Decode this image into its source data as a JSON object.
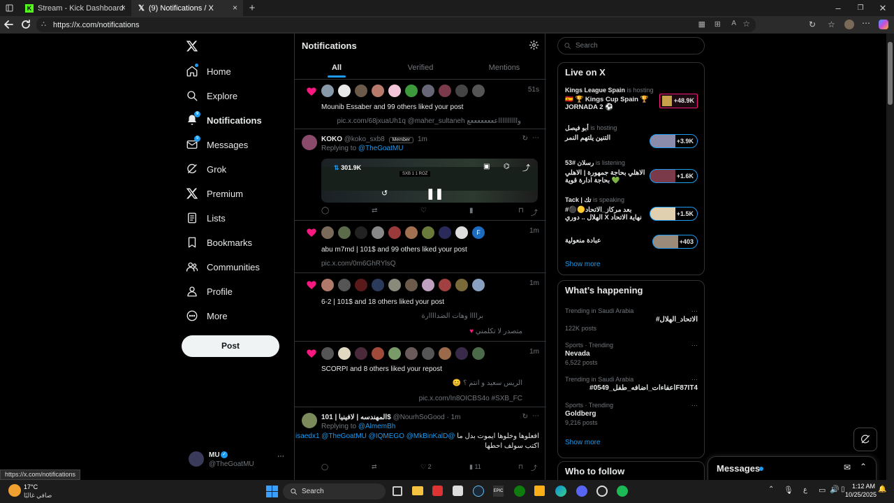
{
  "browser": {
    "tabs": [
      {
        "title": "Stream - Kick Dashboard",
        "active": false
      },
      {
        "title": "(9) Notifications / X",
        "active": true
      }
    ],
    "url": "https://x.com/notifications",
    "status_url": "https://x.com/notifications"
  },
  "nav": {
    "items": [
      {
        "label": "Home",
        "icon": "home-icon"
      },
      {
        "label": "Explore",
        "icon": "search-icon"
      },
      {
        "label": "Notifications",
        "icon": "bell-icon",
        "badge": "9"
      },
      {
        "label": "Messages",
        "icon": "mail-icon",
        "badge": "9"
      },
      {
        "label": "Grok",
        "icon": "grok-icon"
      },
      {
        "label": "Premium",
        "icon": "x-logo-icon"
      },
      {
        "label": "Lists",
        "icon": "list-icon"
      },
      {
        "label": "Bookmarks",
        "icon": "bookmark-icon"
      },
      {
        "label": "Communities",
        "icon": "people-icon"
      },
      {
        "label": "Profile",
        "icon": "person-icon"
      },
      {
        "label": "More",
        "icon": "more-circle-icon"
      }
    ],
    "post_label": "Post",
    "account": {
      "name": "MU",
      "handle": "@TheGoatMU"
    }
  },
  "main": {
    "title": "Notifications",
    "tabs": [
      "All",
      "Verified",
      "Mentions"
    ],
    "notifs": [
      {
        "time": "51s",
        "text": "Mounib Essaber and 99 others liked your post",
        "sub": "pic.x.com/68jxuaUh1q @maher_sultaneh وااااااااااععععععععع"
      },
      {
        "time": "1m",
        "text": "abu m7md | 101$ and 99 others liked your post",
        "sub": "pic.x.com/0m6GhRYlsQ"
      },
      {
        "time": "1m",
        "text": "6-2 | 101$ and 18 others liked your post",
        "sub": "براااا وهات الضداااارة",
        "sub2": "متصدر لا تكلمني"
      },
      {
        "time": "1m",
        "text": "SCORPI and 8 others liked your repost",
        "sub": "الريس سعيد و انتم ؟",
        "sub2": "pic.x.com/In8OICBS4o #SXB_FC"
      }
    ],
    "reply1": {
      "name": "KOKO",
      "handle": "@koko_sxb8",
      "member_badge": "Member",
      "time": "1m",
      "replying": "Replying to",
      "replying_to": "@TheGoatMU",
      "video_views": "301.9K",
      "video_score": "SXB 1 1 ROZ"
    },
    "reply2": {
      "name": "101 | المهندسه | لافينيا$",
      "handle": "@NourhSoGood",
      "time": "1m",
      "replying": "Replying to",
      "replying_to": "@AlmemBh",
      "mentions": "@isaedx1 @TheGoatMU @IQMEGO @MkBinKalD",
      "text1": "افعلوها وخلوها ايموت بدل ما",
      "text2": "اكتب سولف احطها",
      "likes": "2",
      "views": "11"
    }
  },
  "search": {
    "placeholder": "Search"
  },
  "live": {
    "title": "Live on X",
    "items": [
      {
        "host": "Kings League Spain",
        "status": "is hosting",
        "title": "🇪🇸 🏆 Kings Cup Spain 🏆 JORNADA 2 ⚽",
        "count": "+48.9K"
      },
      {
        "host": "أبو فيصل",
        "status": "is hosting",
        "title": "التنين يلتهم النمر",
        "count": "+3.9K"
      },
      {
        "host": "53# رسلان",
        "status": "is listening",
        "title": "الاهلي بحاجة جمهورة | الاهلي بحاجة ادارة قوية 💚",
        "count": "+1.6K"
      },
      {
        "host": "Tack | تك",
        "status": "is speaking",
        "title": "#بعد مركاز_الاتحاد🟡⚫ الهلال .. دوري X نهاية الاتحاد",
        "count": "+1.5K"
      },
      {
        "host": "",
        "status": "",
        "title": "عبادة منعولية",
        "count": "+403"
      }
    ],
    "show_more": "Show more"
  },
  "happening": {
    "title": "What’s happening",
    "trends": [
      {
        "context": "Trending in Saudi Arabia",
        "name": "#الاتحاد_الهلال",
        "posts": "122K posts"
      },
      {
        "context": "Sports · Trending",
        "name": "Nevada",
        "posts": "6,522 posts"
      },
      {
        "context": "Trending in Saudi Arabia",
        "name": "#اعفاءات_اضافه_طفل_0549F87IT4",
        "posts": ""
      },
      {
        "context": "Sports · Trending",
        "name": "Goldberg",
        "posts": "9,216 posts"
      }
    ],
    "show_more": "Show more"
  },
  "who_to_follow": {
    "title": "Who to follow"
  },
  "messages_drawer": {
    "title": "Messages"
  },
  "taskbar": {
    "weather_temp": "17°C",
    "weather_desc": "صافي غالبًا",
    "search_label": "Search",
    "lang": "ع",
    "time": "1:12 AM",
    "date": "10/25/2025"
  },
  "colors": {
    "accent": "#1d9bf0",
    "like": "#f91880",
    "bg": "#000000"
  }
}
